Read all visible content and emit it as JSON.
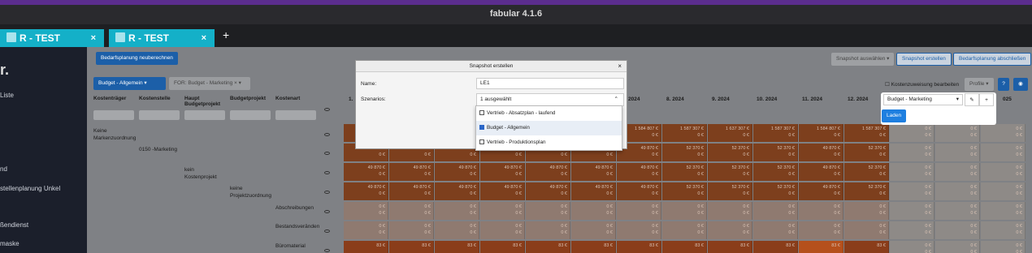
{
  "window": {
    "title": "fabular 4.1.6"
  },
  "tabs": [
    {
      "label": "R - TEST",
      "close": "×"
    },
    {
      "label": "R - TEST",
      "close": "×"
    }
  ],
  "new_tab": "+",
  "sidebar": {
    "logo": "r.",
    "items": [
      "Liste",
      "nd",
      "stellenplanung Unkel",
      "ßendienst",
      "maske"
    ]
  },
  "toolbar": {
    "recalc": "Bedarfsplanung neuberechnen",
    "snapshot_select": "Snapshot auswählen",
    "snapshot_create": "Snapshot erstellen",
    "close_planning": "Bedarfsplanung abschließen",
    "cost_allocation": "Kostenzuweisung bearbeiten",
    "profile": "Profile"
  },
  "filters": {
    "budget": "Budget - Allgemein",
    "for": "FOR: Budget - Marketing"
  },
  "columns": [
    "Kostenträger",
    "Kostenstelle",
    "Haupt Budgetprojekt",
    "Budgetprojekt",
    "Kostenart"
  ],
  "months": [
    "1.",
    "2024",
    "8. 2024",
    "9. 2024",
    "10. 2024",
    "11. 2024",
    "12. 2024",
    "025"
  ],
  "tree": [
    {
      "label": "Keine Markenzuordnung"
    },
    {
      "label": "0150 -Marketing"
    },
    {
      "label": "kein Kostenprojekt"
    },
    {
      "label": "keine Projektzuordnung"
    },
    {
      "label": "Abschreibungen"
    },
    {
      "label": "Bestandsveränden"
    },
    {
      "label": "Büromaterial"
    }
  ],
  "grid": {
    "row1": [
      "1 584 807 €",
      "1 584 807 €",
      "1 584 807 €",
      "",
      "",
      "",
      "1 584 807 €",
      "1 587 307 €",
      "1 637 307 €",
      "1 587 307 €",
      "1 584 807 €",
      "1 587 307 €"
    ],
    "row2": [
      "49 870 €",
      "49 870 €",
      "49 870 €",
      "49 870 €",
      "49 870 €",
      "49 870 €",
      "49 870 €",
      "52 370 €",
      "52 370 €",
      "52 370 €",
      "49 870 €",
      "52 370 €"
    ],
    "zero": "0 €",
    "small": "83 €"
  },
  "modal": {
    "title": "Snapshot erstellen",
    "close": "×",
    "name_label": "Name:",
    "name_value": "LE1",
    "scenarios_label": "Szenarios:",
    "scenarios_value": "1 ausgewählt",
    "options": [
      {
        "label": "Vertrieb - Absatzplan - laufend",
        "checked": false
      },
      {
        "label": "Budget - Allgemein",
        "checked": true
      },
      {
        "label": "Vertrieb - Produktionsplan",
        "checked": false
      }
    ]
  },
  "popover": {
    "select_value": "Budget - Marketing",
    "load_button": "Laden"
  }
}
